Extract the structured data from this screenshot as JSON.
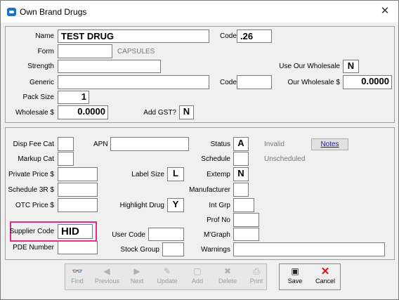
{
  "window": {
    "title": "Own Brand Drugs",
    "close_symbol": "✕"
  },
  "top": {
    "name_label": "Name",
    "name_value": "TEST DRUG",
    "code_label": "Code",
    "code_value": ".26",
    "form_label": "Form",
    "form_value": "",
    "form_hint": "CAPSULES",
    "strength_label": "Strength",
    "strength_value": "",
    "use_wholesale_label": "Use Our Wholesale",
    "use_wholesale_value": "N",
    "generic_label": "Generic",
    "generic_value": "",
    "generic_code_label": "Code",
    "generic_code_value": "",
    "our_wholesale_label": "Our Wholesale $",
    "our_wholesale_value": "0.0000",
    "pack_size_label": "Pack Size",
    "pack_size_value": "1",
    "wholesale_label": "Wholesale $",
    "wholesale_value": "0.0000",
    "add_gst_label": "Add GST?",
    "add_gst_value": "N"
  },
  "bottom": {
    "disp_fee_cat_label": "Disp Fee Cat",
    "disp_fee_cat_value": "",
    "apn_label": "APN",
    "apn_value": "",
    "status_label": "Status",
    "status_value": "A",
    "status_text": "Invalid",
    "notes_label": "Notes",
    "markup_cat_label": "Markup Cat",
    "markup_cat_value": "",
    "schedule_label": "Schedule",
    "schedule_value": "",
    "schedule_text": "Unscheduled",
    "private_price_label": "Private Price $",
    "private_price_value": "",
    "label_size_label": "Label Size",
    "label_size_value": "L",
    "extemp_label": "Extemp",
    "extemp_value": "N",
    "schedule3r_label": "Schedule 3R $",
    "schedule3r_value": "",
    "manufacturer_label": "Manufacturer",
    "manufacturer_value": "",
    "otc_price_label": "OTC Price $",
    "otc_price_value": "",
    "highlight_drug_label": "Highlight Drug",
    "highlight_drug_value": "Y",
    "int_grp_label": "Int Grp",
    "int_grp_value": "",
    "prof_no_label": "Prof No",
    "prof_no_value": "",
    "supplier_code_label": "Supplier Code",
    "supplier_code_value": "HID",
    "user_code_label": "User Code",
    "user_code_value": "",
    "mgraph_label": "M'Graph",
    "mgraph_value": "",
    "pde_number_label": "PDE Number",
    "pde_number_value": "",
    "stock_group_label": "Stock Group",
    "stock_group_value": "",
    "warnings_label": "Warnings",
    "warnings_value": ""
  },
  "toolbar": {
    "find": "Find",
    "previous": "Previous",
    "next": "Next",
    "update": "Update",
    "add": "Add",
    "delete": "Delete",
    "print": "Print",
    "save": "Save",
    "cancel": "Cancel"
  },
  "colors": {
    "highlight": "#e02b8e",
    "title_icon": "#1a73c8",
    "cancel_icon": "#e01010"
  }
}
